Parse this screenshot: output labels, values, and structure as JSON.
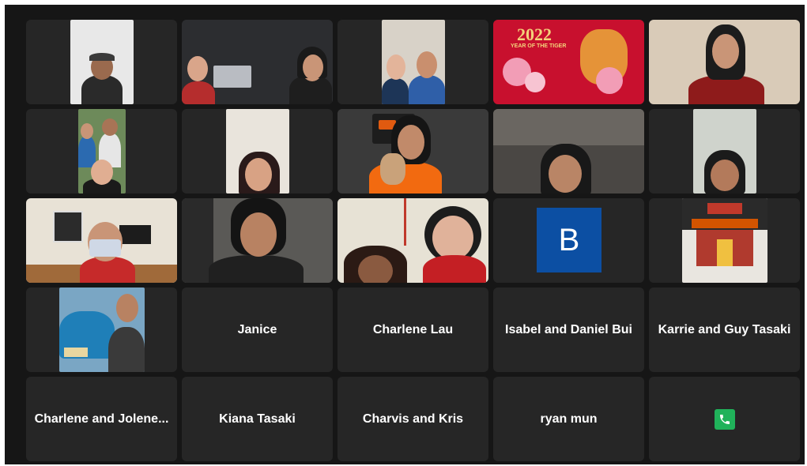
{
  "window": {
    "title": ""
  },
  "tiles": [
    {
      "id": "t1",
      "kind": "video"
    },
    {
      "id": "t2",
      "kind": "video"
    },
    {
      "id": "t3",
      "kind": "video"
    },
    {
      "id": "t4",
      "kind": "image",
      "text_top": "2022",
      "text_sub": "YEAR OF THE TIGER"
    },
    {
      "id": "t5",
      "kind": "video"
    },
    {
      "id": "t6",
      "kind": "video"
    },
    {
      "id": "t7",
      "kind": "video"
    },
    {
      "id": "t8",
      "kind": "video"
    },
    {
      "id": "t9",
      "kind": "video"
    },
    {
      "id": "t10",
      "kind": "video"
    },
    {
      "id": "t11",
      "kind": "video"
    },
    {
      "id": "t12",
      "kind": "video"
    },
    {
      "id": "t13",
      "kind": "video"
    },
    {
      "id": "t14",
      "kind": "avatar",
      "letter": "B",
      "color": "#0c4fa3"
    },
    {
      "id": "t15",
      "kind": "image"
    },
    {
      "id": "t16",
      "kind": "image"
    },
    {
      "id": "t17",
      "kind": "name",
      "name": "Janice"
    },
    {
      "id": "t18",
      "kind": "name",
      "name": "Charlene Lau"
    },
    {
      "id": "t19",
      "kind": "name",
      "name": "Isabel and Daniel Bui"
    },
    {
      "id": "t20",
      "kind": "name",
      "name": "Karrie and Guy Tasaki"
    },
    {
      "id": "t21",
      "kind": "name",
      "name": "Charlene and Jolene..."
    },
    {
      "id": "t22",
      "kind": "name",
      "name": "Kiana Tasaki"
    },
    {
      "id": "t23",
      "kind": "name",
      "name": "Charvis and Kris"
    },
    {
      "id": "t24",
      "kind": "name",
      "name": "ryan mun"
    },
    {
      "id": "t25",
      "kind": "phone",
      "icon": "phone-icon",
      "color": "#20b25a"
    }
  ]
}
